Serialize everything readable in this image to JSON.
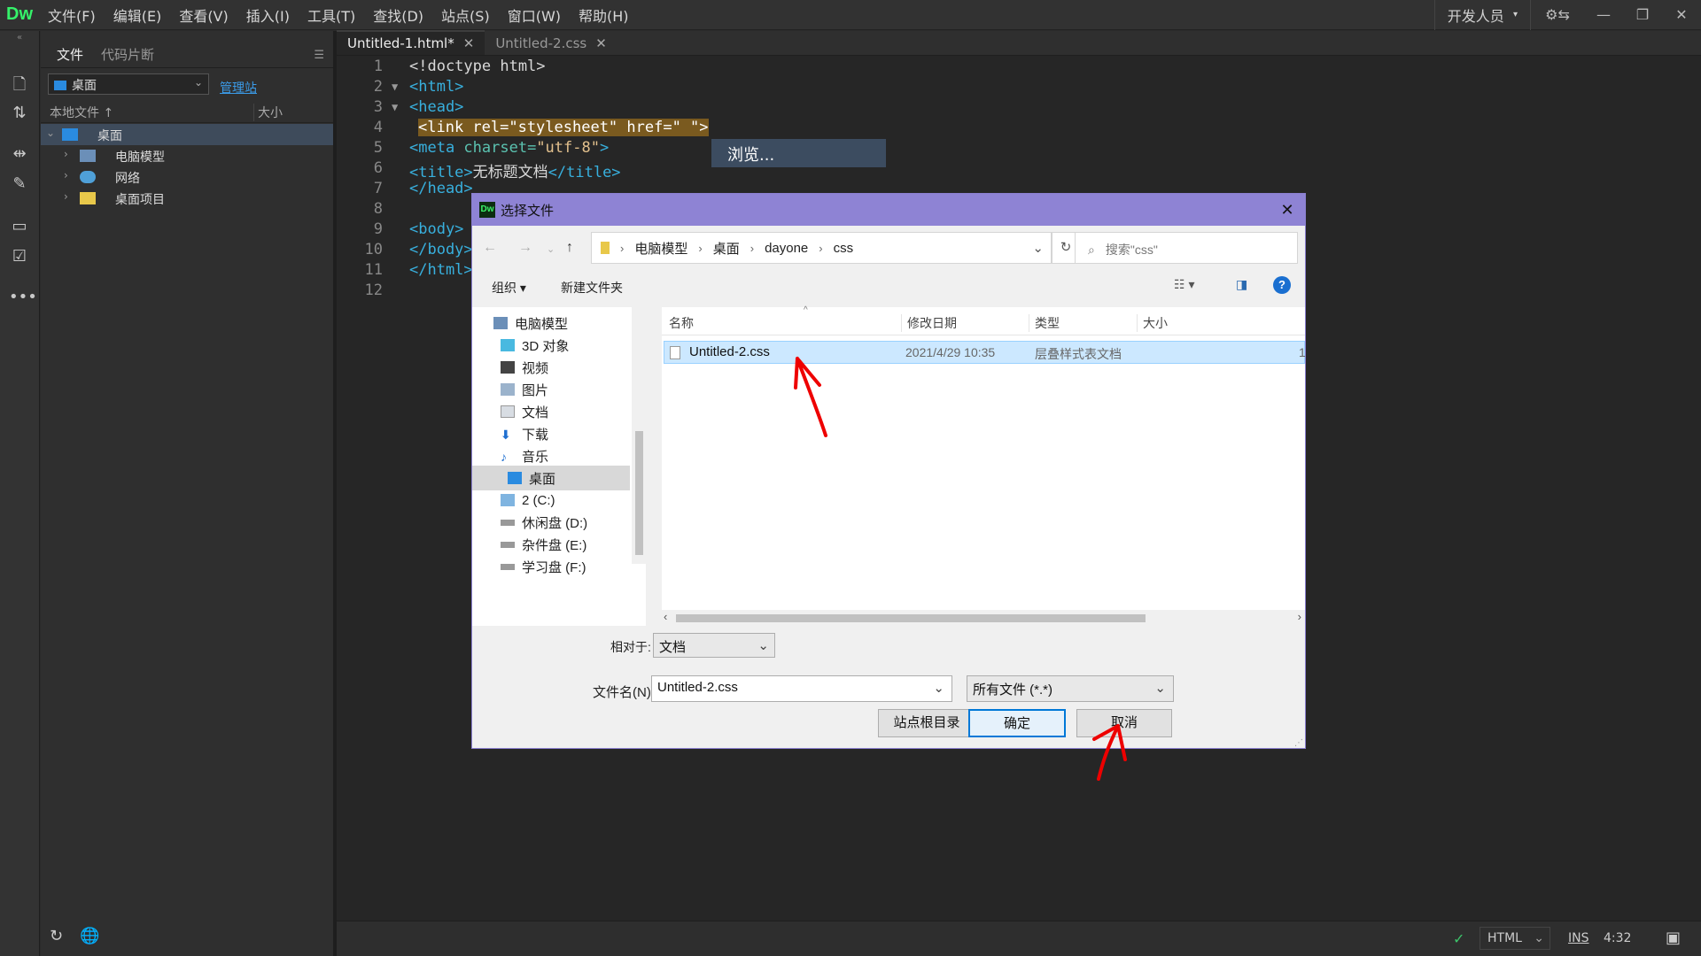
{
  "app": {
    "logo": "Dw"
  },
  "menu": {
    "items": [
      "文件(F)",
      "编辑(E)",
      "查看(V)",
      "插入(I)",
      "工具(T)",
      "查找(D)",
      "站点(S)",
      "窗口(W)",
      "帮助(H)"
    ],
    "workspace": "开发人员"
  },
  "files_panel": {
    "tabs": [
      "文件",
      "代码片断"
    ],
    "site": "桌面",
    "manage_link": "管理站",
    "col_local": "本地文件",
    "col_size": "大小",
    "tree": [
      {
        "label": "桌面",
        "selected": true
      },
      {
        "label": "电脑模型"
      },
      {
        "label": "网络"
      },
      {
        "label": "桌面项目"
      }
    ]
  },
  "editor": {
    "tabs": [
      {
        "label": "Untitled-1.html*",
        "active": true
      },
      {
        "label": "Untitled-2.css",
        "active": false
      }
    ],
    "lines": {
      "l1": "<!doctype html>",
      "l2": "<html>",
      "l3": "<head>",
      "l4": "<link rel=\"stylesheet\" href=\" \">",
      "l5a": "<meta ",
      "l5b": "charset=",
      "l5c": "\"utf-8\"",
      "l5d": ">",
      "l6a": "<title>",
      "l6b": "无标题文档",
      "l6c": "</title>",
      "l7": "</head>",
      "l9": "<body>",
      "l10": "</body>",
      "l11": "</html>"
    },
    "line_numbers": [
      "1",
      "2",
      "3",
      "4",
      "5",
      "6",
      "7",
      "8",
      "9",
      "10",
      "11",
      "12"
    ],
    "hint": "浏览..."
  },
  "statusbar": {
    "mode": "HTML",
    "ins": "INS",
    "pos": "4:32"
  },
  "dialog": {
    "title": "选择文件",
    "breadcrumb": [
      "电脑模型",
      "桌面",
      "dayone",
      "css"
    ],
    "search_placeholder": "搜索\"css\"",
    "organize": "组织",
    "new_folder": "新建文件夹",
    "nav_items": [
      "电脑模型",
      "3D 对象",
      "视频",
      "图片",
      "文档",
      "下载",
      "音乐",
      "桌面",
      "2 (C:)",
      "休闲盘 (D:)",
      "杂件盘 (E:)",
      "学习盘 (F:)"
    ],
    "columns": [
      "名称",
      "修改日期",
      "类型",
      "大小"
    ],
    "file": {
      "name": "Untitled-2.css",
      "date": "2021/4/29 10:35",
      "type": "层叠样式表文档",
      "size": "1"
    },
    "relative_label": "相对于:",
    "relative_value": "文档",
    "filename_label": "文件名(N):",
    "filename_value": "Untitled-2.css",
    "filetype_value": "所有文件 (*.*)",
    "site_root_button": "站点根目录",
    "ok_button": "确定",
    "cancel_button": "取消"
  },
  "colors": {
    "accent": "#0078d7",
    "dialog_title": "#8e83d4",
    "annotation": "#e00000"
  }
}
